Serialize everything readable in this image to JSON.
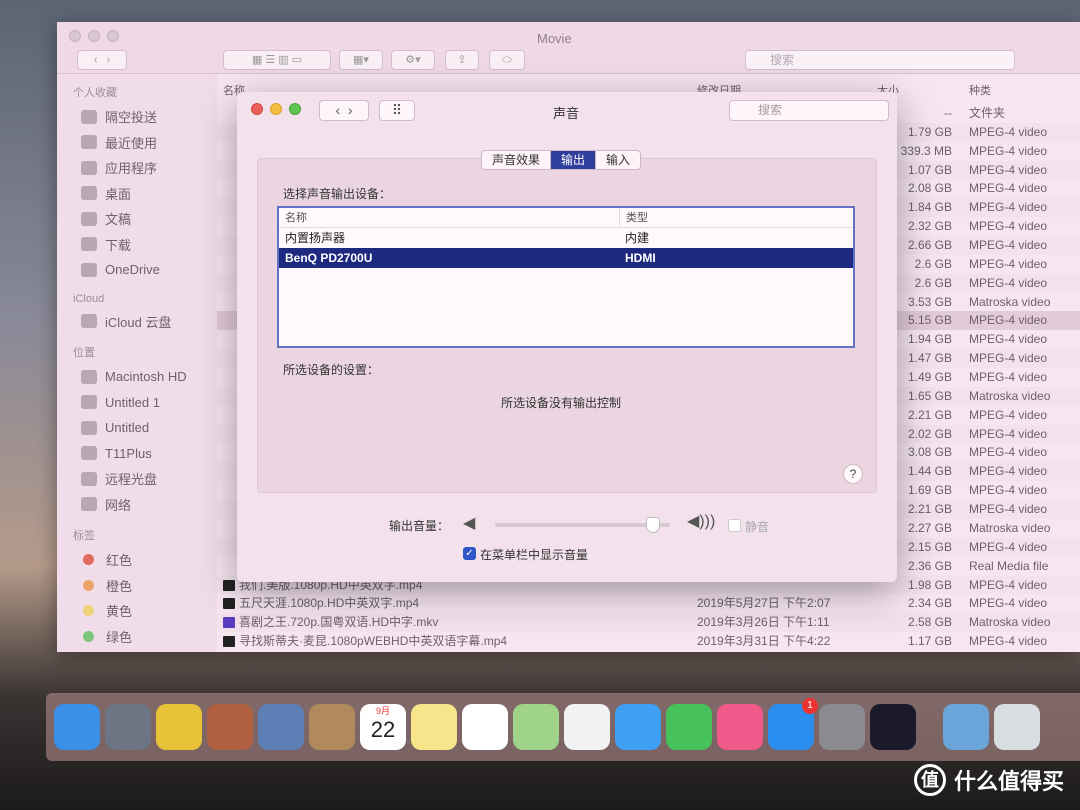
{
  "finder": {
    "title": "Movie",
    "search_placeholder": "搜索",
    "sidebar": {
      "favorites_header": "个人收藏",
      "favorites": [
        "隔空投送",
        "最近使用",
        "应用程序",
        "桌面",
        "文稿",
        "下载",
        "OneDrive"
      ],
      "icloud_header": "iCloud",
      "icloud": [
        "iCloud 云盘"
      ],
      "locations_header": "位置",
      "locations": [
        "Macintosh HD",
        "Untitled 1",
        "Untitled",
        "T11Plus",
        "远程光盘",
        "网络"
      ],
      "tags_header": "标签",
      "tags": [
        {
          "label": "红色",
          "color": "#e06a60"
        },
        {
          "label": "橙色",
          "color": "#eaa468"
        },
        {
          "label": "黄色",
          "color": "#eed27a"
        },
        {
          "label": "绿色",
          "color": "#7cc47a"
        }
      ]
    },
    "columns": {
      "name": "名称",
      "date": "修改日期",
      "size": "大小",
      "kind": "种类"
    },
    "rows": [
      {
        "size": "--",
        "kind": "文件夹"
      },
      {
        "size": "1.79 GB",
        "kind": "MPEG-4 video"
      },
      {
        "size": "339.3 MB",
        "kind": "MPEG-4 video"
      },
      {
        "size": "1.07 GB",
        "kind": "MPEG-4 video"
      },
      {
        "size": "2.08 GB",
        "kind": "MPEG-4 video"
      },
      {
        "size": "1.84 GB",
        "kind": "MPEG-4 video"
      },
      {
        "size": "2.32 GB",
        "kind": "MPEG-4 video"
      },
      {
        "size": "2.66 GB",
        "kind": "MPEG-4 video"
      },
      {
        "size": "2.6 GB",
        "kind": "MPEG-4 video"
      },
      {
        "size": "2.6 GB",
        "kind": "MPEG-4 video"
      },
      {
        "size": "3.53 GB",
        "kind": "Matroska video"
      },
      {
        "size": "5.15 GB",
        "kind": "MPEG-4 video"
      },
      {
        "size": "1.94 GB",
        "kind": "MPEG-4 video"
      },
      {
        "size": "1.47 GB",
        "kind": "MPEG-4 video"
      },
      {
        "size": "1.49 GB",
        "kind": "MPEG-4 video"
      },
      {
        "size": "1.65 GB",
        "kind": "Matroska video"
      },
      {
        "size": "2.21 GB",
        "kind": "MPEG-4 video"
      },
      {
        "size": "2.02 GB",
        "kind": "MPEG-4 video"
      },
      {
        "size": "3.08 GB",
        "kind": "MPEG-4 video"
      },
      {
        "size": "1.44 GB",
        "kind": "MPEG-4 video"
      },
      {
        "size": "1.69 GB",
        "kind": "MPEG-4 video"
      },
      {
        "size": "2.21 GB",
        "kind": "MPEG-4 video"
      },
      {
        "size": "2.27 GB",
        "kind": "Matroska video"
      },
      {
        "size": "2.15 GB",
        "kind": "MPEG-4 video"
      },
      {
        "size": "2.36 GB",
        "kind": "Real Media file"
      },
      {
        "name": "我们.美版.1080p.HD中英双字.mp4",
        "size": "1.98 GB",
        "kind": "MPEG-4 video"
      },
      {
        "name": "五尺天涯.1080p.HD中英双字.mp4",
        "date": "2019年5月27日 下午2:07",
        "size": "2.34 GB",
        "kind": "MPEG-4 video"
      },
      {
        "name": "喜剧之王.720p.国粤双语.HD中字.mkv",
        "date": "2019年3月26日 下午1:11",
        "size": "2.58 GB",
        "kind": "Matroska video"
      },
      {
        "name": "寻找斯蒂夫·麦昆.1080pWEBHD中英双语字幕.mp4",
        "date": "2019年3月31日 下午4:22",
        "size": "1.17 GB",
        "kind": "MPEG-4 video"
      }
    ]
  },
  "sound": {
    "title": "声音",
    "search_placeholder": "搜索",
    "tabs": [
      {
        "label": "声音效果",
        "active": false
      },
      {
        "label": "输出",
        "active": true
      },
      {
        "label": "输入",
        "active": false
      }
    ],
    "select_label": "选择声音输出设备：",
    "table": {
      "col_name": "名称",
      "col_type": "类型",
      "rows": [
        {
          "name": "内置扬声器",
          "type": "内建",
          "selected": false
        },
        {
          "name": "BenQ PD2700U",
          "type": "HDMI",
          "selected": true
        }
      ]
    },
    "settings_label": "所选设备的设置：",
    "no_controls": "所选设备没有输出控制",
    "help": "?",
    "volume_label": "输出音量：",
    "volume_level": 0.9,
    "mute_label": "静音",
    "mute_checked": false,
    "show_in_menubar_label": "在菜单栏中显示音量",
    "show_in_menubar_checked": true,
    "accent": "#2f3e9c"
  },
  "dock": {
    "apps": [
      "finder",
      "launchpad",
      "chrome",
      "calculator",
      "preview",
      "contacts",
      "calendar",
      "notes",
      "reminders",
      "maps",
      "photos",
      "messages",
      "facetime",
      "itunes",
      "app-store",
      "system-preferences",
      "quicktime",
      "downloads",
      "trash"
    ],
    "calendar_month": "9月",
    "calendar_day": "22",
    "app_store_badge": "1"
  },
  "watermark": {
    "text": "什么值得买",
    "logo": "值"
  }
}
